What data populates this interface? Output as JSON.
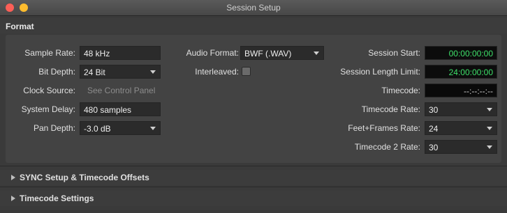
{
  "window": {
    "title": "Session Setup"
  },
  "format": {
    "header": "Format",
    "sample_rate": {
      "label": "Sample Rate:",
      "value": "48 kHz"
    },
    "bit_depth": {
      "label": "Bit Depth:",
      "value": "24 Bit"
    },
    "clock_source": {
      "label": "Clock Source:",
      "value": "See Control Panel"
    },
    "system_delay": {
      "label": "System Delay:",
      "value": "480 samples"
    },
    "pan_depth": {
      "label": "Pan Depth:",
      "value": "-3.0 dB"
    },
    "audio_format": {
      "label": "Audio Format:",
      "value": "BWF (.WAV)"
    },
    "interleaved": {
      "label": "Interleaved:",
      "checked": false
    },
    "session_start": {
      "label": "Session Start:",
      "value": "00:00:00:00"
    },
    "session_length_limit": {
      "label": "Session Length Limit:",
      "value": "24:00:00:00"
    },
    "timecode": {
      "label": "Timecode:",
      "value": "--:--:--:--"
    },
    "timecode_rate": {
      "label": "Timecode Rate:",
      "value": "30"
    },
    "feet_frames_rate": {
      "label": "Feet+Frames Rate:",
      "value": "24"
    },
    "timecode2_rate": {
      "label": "Timecode 2 Rate:",
      "value": "30"
    }
  },
  "sections": {
    "sync": "SYNC Setup & Timecode Offsets",
    "timecode_settings": "Timecode Settings"
  },
  "colors": {
    "timecode_green": "#3ee06a"
  }
}
